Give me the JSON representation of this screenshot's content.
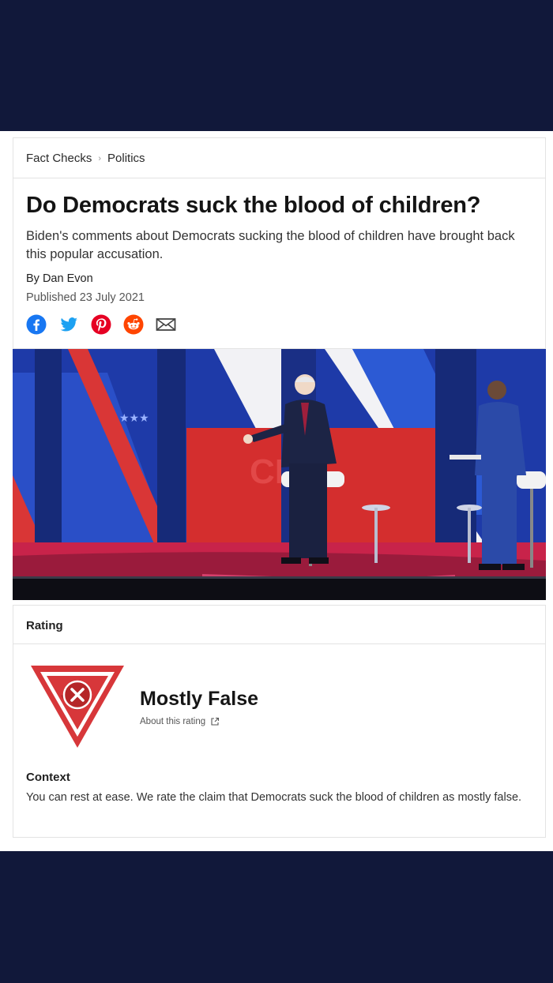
{
  "breadcrumb": {
    "items": [
      "Fact Checks",
      "Politics"
    ],
    "separator": "›"
  },
  "article": {
    "title": "Do Democrats suck the blood of children?",
    "subtitle": "Biden's comments about Democrats sucking the blood of children have brought back this popular accusation.",
    "byline": "By Dan Evon",
    "published": "Published 23 July 2021",
    "share_icons": [
      "facebook-icon",
      "twitter-icon",
      "pinterest-icon",
      "reddit-icon",
      "email-icon"
    ]
  },
  "hero_image": {
    "stars": "★★★",
    "logo_text": "CNN"
  },
  "rating": {
    "label": "Rating",
    "value": "Mostly False",
    "about": "About this rating",
    "color": "#d7373a"
  },
  "context": {
    "title": "Context",
    "text": "You can rest at ease. We rate the claim that Democrats suck the blood of children as mostly false."
  },
  "colors": {
    "background": "#11183a",
    "facebook": "#1877f2",
    "twitter": "#1da1f2",
    "pinterest": "#e60023",
    "reddit": "#ff4500"
  }
}
